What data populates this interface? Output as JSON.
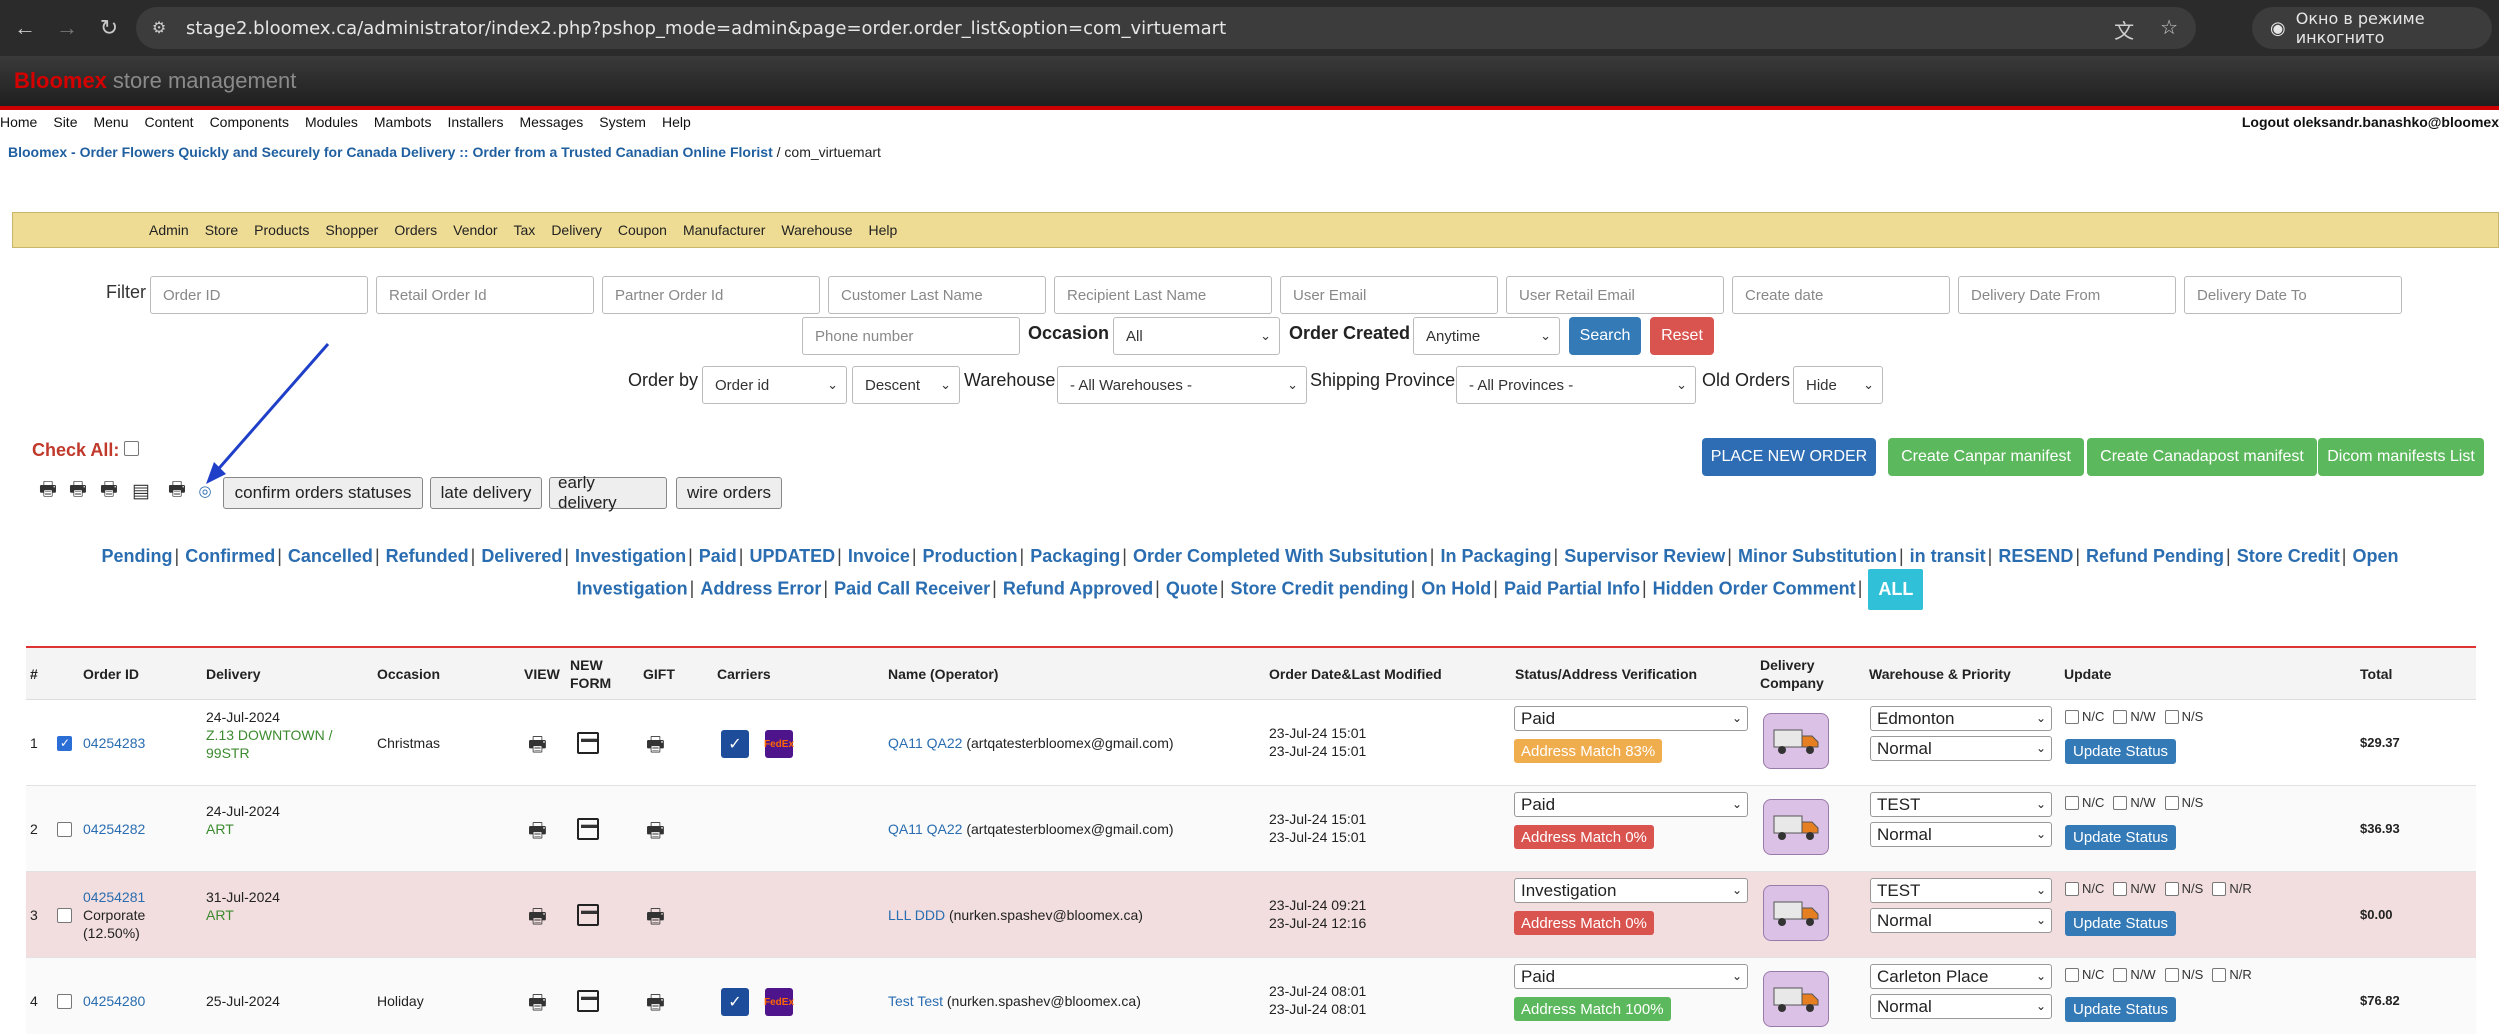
{
  "browser": {
    "url": "stage2.bloomex.ca/administrator/index2.php?pshop_mode=admin&page=order.order_list&option=com_virtuemart",
    "incognito_label": "Окно в режиме инкогнито"
  },
  "header": {
    "brand_red": "Bloomex",
    "brand_gray": "store management"
  },
  "menubar": [
    "Home",
    "Site",
    "Menu",
    "Content",
    "Components",
    "Modules",
    "Mambots",
    "Installers",
    "Messages",
    "System",
    "Help"
  ],
  "logout": "Logout oleksandr.banashko@bloomex",
  "breadcrumb": {
    "link": "Bloomex - Order Flowers Quickly and Securely for Canada Delivery :: Order from a Trusted Canadian Online Florist",
    "rest": " / com_virtuemart"
  },
  "store_menu": [
    "Admin",
    "Store",
    "Products",
    "Shopper",
    "Orders",
    "Vendor",
    "Tax",
    "Delivery",
    "Coupon",
    "Manufacturer",
    "Warehouse",
    "Help"
  ],
  "filter": {
    "label": "Filter",
    "placeholders": [
      "Order ID",
      "Retail Order Id",
      "Partner Order Id",
      "Customer Last Name",
      "Recipient Last Name",
      "User Email",
      "User Retail Email",
      "Create date",
      "Delivery Date From",
      "Delivery Date To"
    ],
    "phone_placeholder": "Phone number",
    "occasion_label": "Occasion",
    "occasion_value": "All",
    "order_created_label": "Order Created",
    "order_created_value": "Anytime",
    "search": "Search",
    "reset": "Reset",
    "order_by_label": "Order by",
    "order_by_value": "Order id",
    "direction_value": "Descent",
    "warehouse_label": "Warehouse",
    "warehouse_value": "- All Warehouses -",
    "province_label": "Shipping Province",
    "province_value": "- All Provinces -",
    "old_orders_label": "Old Orders",
    "old_orders_value": "Hide"
  },
  "check_all": "Check All:",
  "actions": {
    "place_new_order": "PLACE NEW ORDER",
    "canpar": "Create Canpar manifest",
    "canadapost": "Create Canadapost manifest",
    "dicom": "Dicom manifests List",
    "confirm": "confirm orders statuses",
    "late": "late delivery",
    "early": "early delivery",
    "wire": "wire orders"
  },
  "statuses_line1": [
    "Pending",
    "Confirmed",
    "Cancelled",
    "Refunded",
    "Delivered",
    "Investigation",
    "Paid",
    "UPDATED",
    "Invoice",
    "Production",
    "Packaging",
    "Order Completed With Subsitution",
    "In Packaging",
    "Supervisor Review",
    "Minor Substitution",
    "in transit",
    "RESEND",
    "Refund Pending",
    "Store Credit",
    "Open"
  ],
  "statuses_line2": [
    "Investigation",
    "Address Error",
    "Paid Call Receiver",
    "Refund Approved",
    "Quote",
    "Store Credit pending",
    "On Hold",
    "Paid Partial Info",
    "Hidden Order Comment"
  ],
  "status_all": "ALL",
  "table": {
    "headers": {
      "num": "#",
      "order_id": "Order ID",
      "delivery": "Delivery",
      "occasion": "Occasion",
      "view": "VIEW",
      "new_form_1": "NEW",
      "new_form_2": "FORM",
      "gift": "GIFT",
      "carriers": "Carriers",
      "name": "Name (Operator)",
      "dates": "Order Date&Last Modified",
      "status": "Status/Address Verification",
      "company_1": "Delivery",
      "company_2": "Company",
      "warehouse": "Warehouse & Priority",
      "update": "Update",
      "total": "Total"
    },
    "update_label": "Update Status",
    "cb_labels": [
      "N/C",
      "N/W",
      "N/S",
      "N/R"
    ],
    "rows": [
      {
        "num": "1",
        "order_id": "04254283",
        "delivery_date": "24-Jul-2024",
        "delivery_note": "Z.13 DOWNTOWN / 99STR",
        "occasion": "Christmas",
        "name": "QA11 QA22",
        "email": "(artqatesterbloomex@gmail.com)",
        "date1": "23-Jul-24 15:01",
        "date2": "23-Jul-24 15:01",
        "status": "Paid",
        "match": "Address Match 83%",
        "warehouse": "Edmonton",
        "priority": "Normal",
        "total": "$29.37"
      },
      {
        "num": "2",
        "order_id": "04254282",
        "delivery_date": "24-Jul-2024",
        "delivery_note": "ART",
        "occasion": "",
        "name": "QA11 QA22",
        "email": "(artqatesterbloomex@gmail.com)",
        "date1": "23-Jul-24 15:01",
        "date2": "23-Jul-24 15:01",
        "status": "Paid",
        "match": "Address Match 0%",
        "warehouse": "TEST",
        "priority": "Normal",
        "total": "$36.93"
      },
      {
        "num": "3",
        "order_id": "04254281",
        "order_extra_1": "Corporate",
        "order_extra_2": "(12.50%)",
        "delivery_date": "31-Jul-2024",
        "delivery_note": "ART",
        "occasion": "",
        "name": "LLL DDD",
        "email": "(nurken.spashev@bloomex.ca)",
        "date1": "23-Jul-24 09:21",
        "date2": "23-Jul-24 12:16",
        "status": "Investigation",
        "match": "Address Match 0%",
        "warehouse": "TEST",
        "priority": "Normal",
        "total": "$0.00"
      },
      {
        "num": "4",
        "order_id": "04254280",
        "delivery_date": "25-Jul-2024",
        "delivery_note": "",
        "occasion": "Holiday",
        "name": "Test Test",
        "email": "(nurken.spashev@bloomex.ca)",
        "date1": "23-Jul-24 08:01",
        "date2": "23-Jul-24 08:01",
        "status": "Paid",
        "match": "Address Match 100%",
        "warehouse": "Carleton Place",
        "priority": "Normal",
        "total": "$76.82"
      }
    ]
  }
}
